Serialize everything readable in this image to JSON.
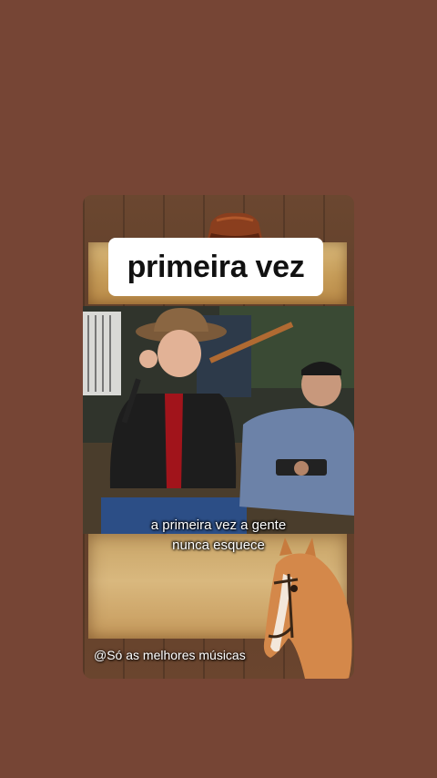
{
  "title": "primeira vez",
  "subtitle": {
    "line1": "a primeira vez a gente",
    "line2": "nunca esquece"
  },
  "watermark": "@Só as melhores músicas",
  "icons": {
    "hat": "cowboy-hat-icon",
    "horse": "horse-head-icon"
  },
  "colors": {
    "background": "#764535",
    "title_bg": "#ffffff",
    "parchment": "#d2b176"
  }
}
